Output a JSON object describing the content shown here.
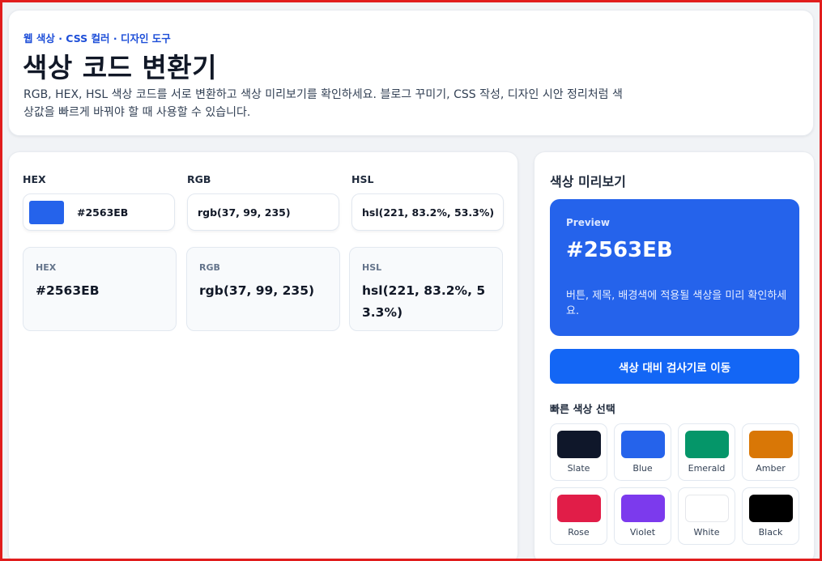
{
  "header": {
    "eyebrow": "웹 색상 · CSS 컬러 · 디자인 도구",
    "title": "색상 코드 변환기",
    "description": "RGB, HEX, HSL 색상 코드를 서로 변환하고 색상 미리보기를 확인하세요. 블로그 꾸미기, CSS 작성, 디자인 시안 정리처럼 색상값을 빠르게 바꿔야 할 때 사용할 수 있습니다."
  },
  "inputs": {
    "hex": {
      "label": "HEX",
      "value": "#2563EB"
    },
    "rgb": {
      "label": "RGB",
      "value": "rgb(37, 99, 235)"
    },
    "hsl": {
      "label": "HSL",
      "value": "hsl(221, 83.2%, 53.3%)"
    }
  },
  "outputs": {
    "hex": {
      "label": "HEX",
      "value": "#2563EB"
    },
    "rgb": {
      "label": "RGB",
      "value": "rgb(37, 99, 235)"
    },
    "hsl": {
      "label": "HSL",
      "value": "hsl(221, 83.2%, 53.3%)"
    }
  },
  "preview": {
    "heading": "색상 미리보기",
    "tag": "Preview",
    "hex": "#2563EB",
    "description": "버튼, 제목, 배경색에 적용될 색상을 미리 확인하세요.",
    "color": "#2563eb"
  },
  "contrast_button": {
    "label": "색상 대비 검사기로 이동"
  },
  "quick": {
    "heading": "빠른 색상 선택",
    "items": [
      {
        "name": "Slate",
        "color": "#0f172a"
      },
      {
        "name": "Blue",
        "color": "#2563eb"
      },
      {
        "name": "Emerald",
        "color": "#059669"
      },
      {
        "name": "Amber",
        "color": "#d97706"
      },
      {
        "name": "Rose",
        "color": "#e11d48"
      },
      {
        "name": "Violet",
        "color": "#7c3aed"
      },
      {
        "name": "White",
        "color": "#ffffff"
      },
      {
        "name": "Black",
        "color": "#000000"
      }
    ]
  },
  "colors": {
    "accent": "#2563eb",
    "button": "#1366f5",
    "frame_border": "#e11d1d"
  }
}
